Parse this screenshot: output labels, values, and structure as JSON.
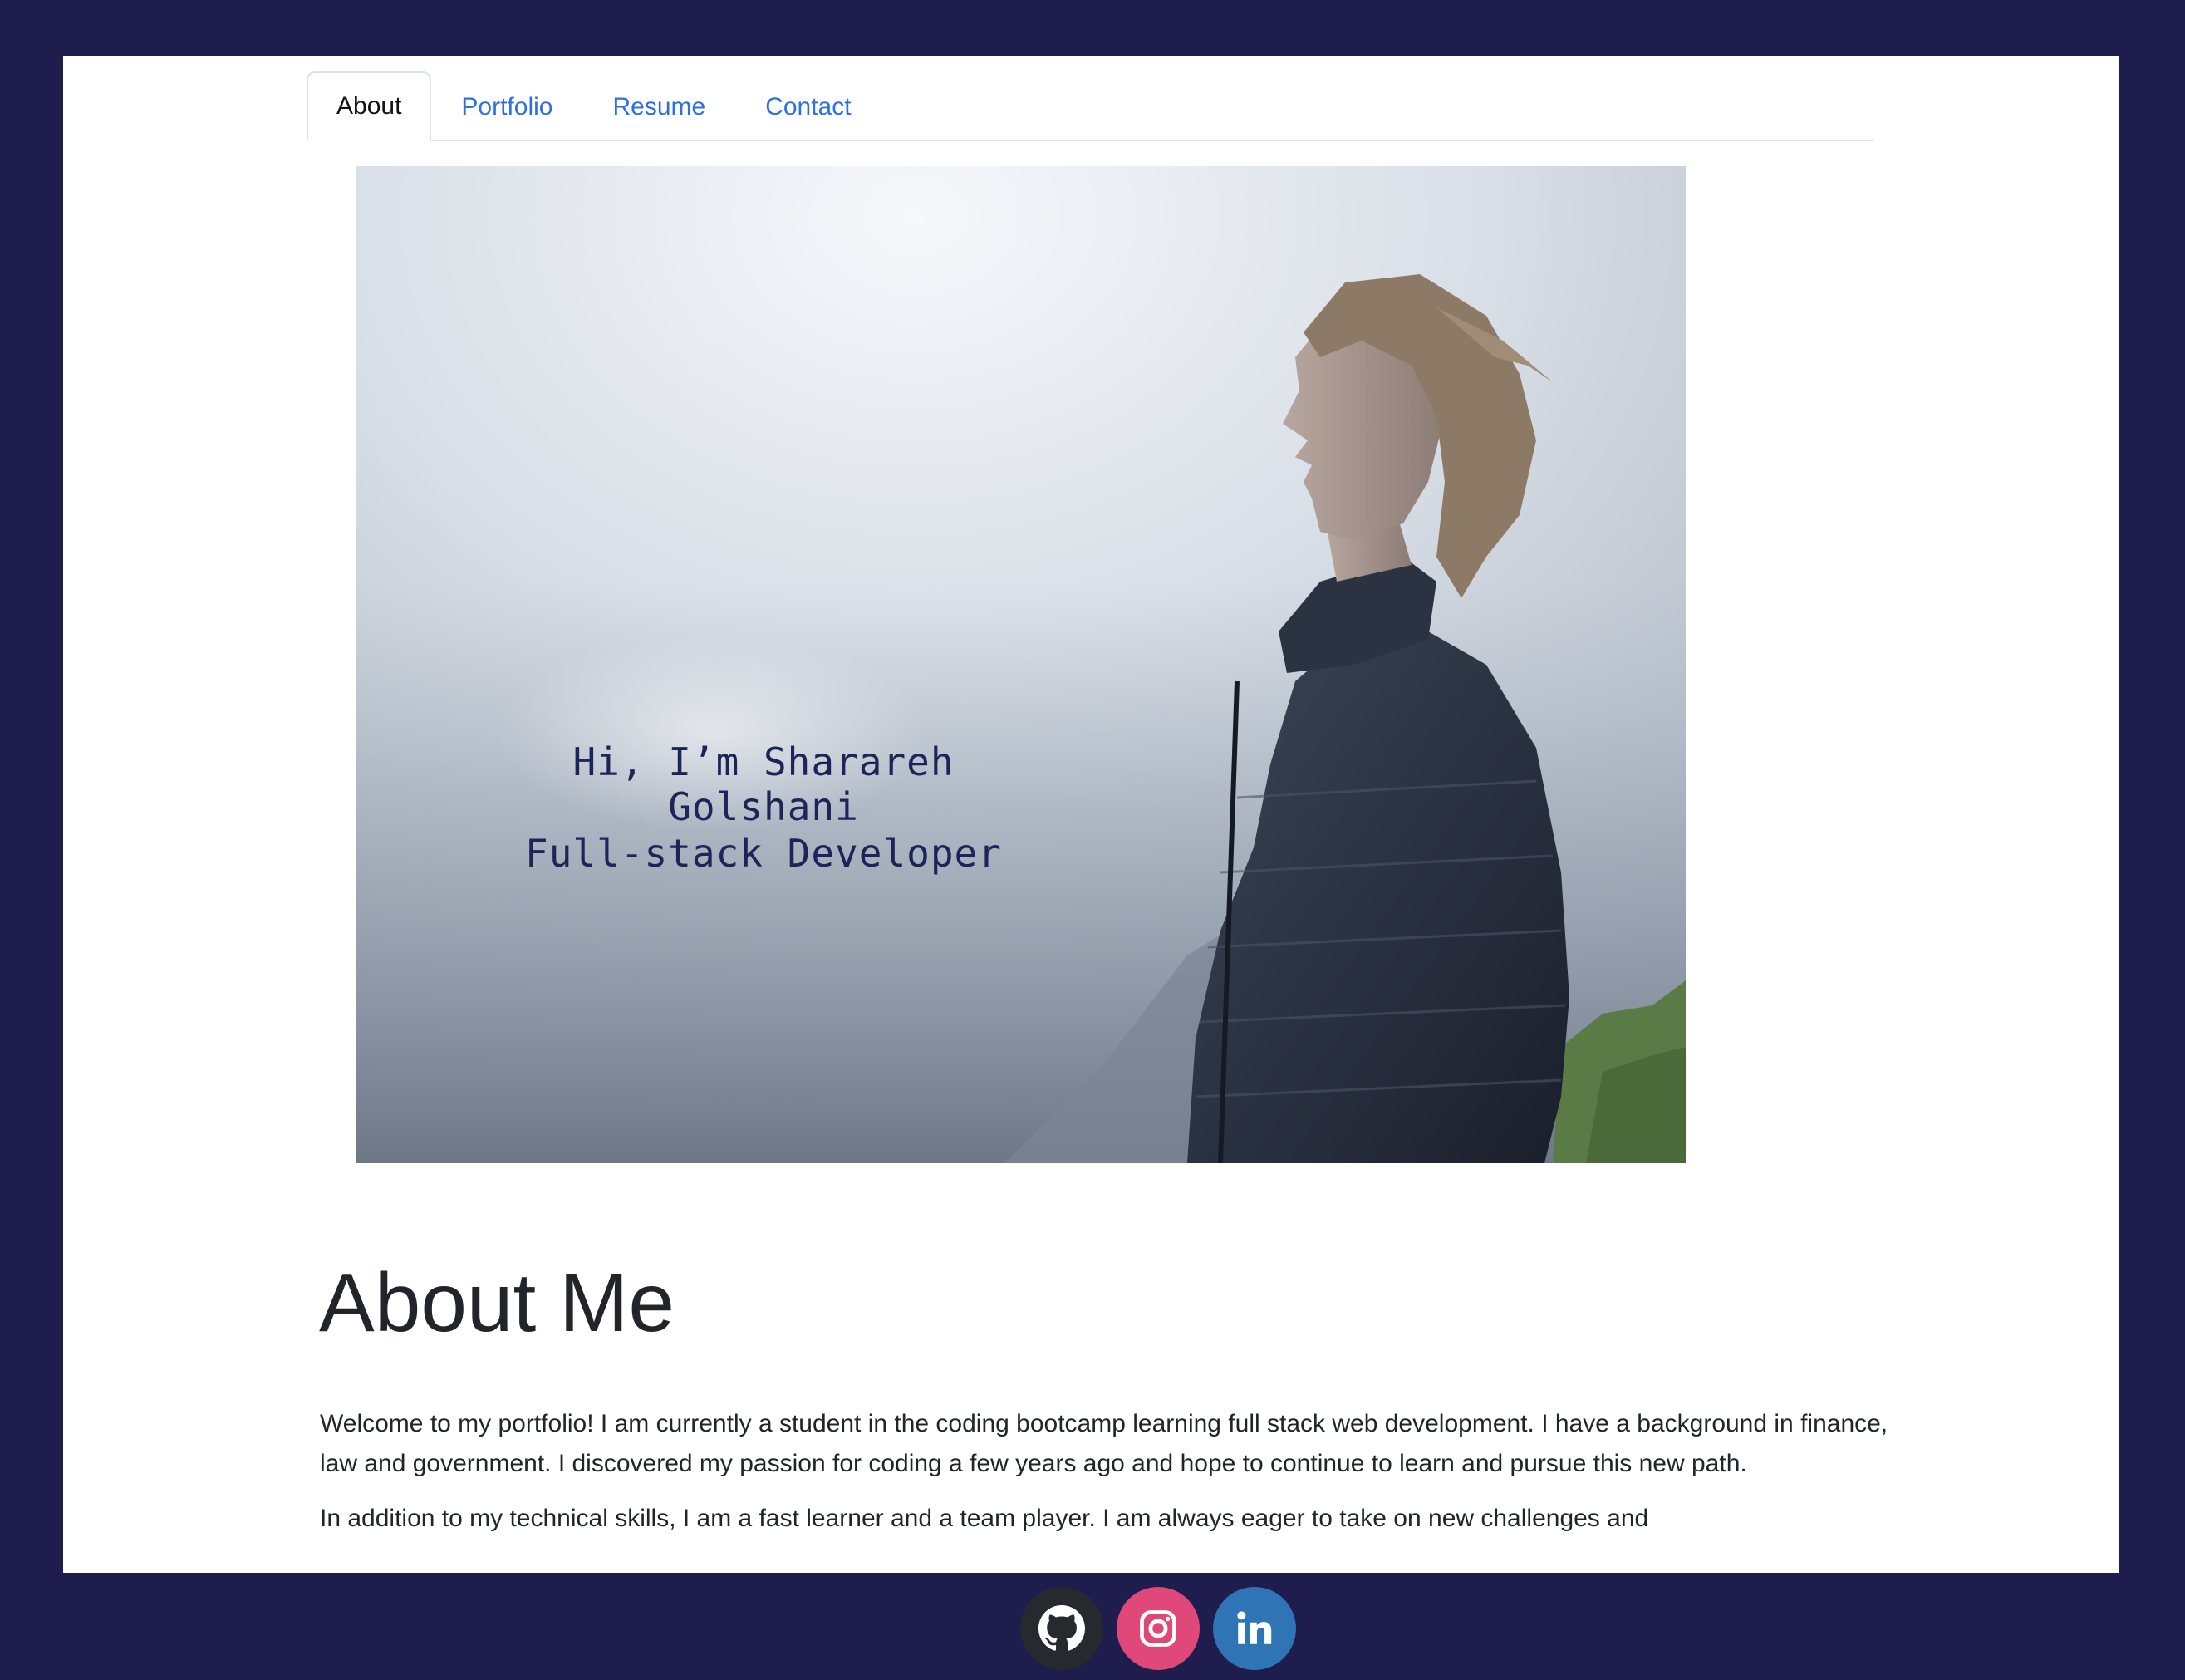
{
  "nav": {
    "tabs": [
      {
        "label": "About",
        "active": true
      },
      {
        "label": "Portfolio",
        "active": false
      },
      {
        "label": "Resume",
        "active": false
      },
      {
        "label": "Contact",
        "active": false
      }
    ]
  },
  "hero": {
    "greeting": "Hi, I’m Sharareh Golshani",
    "role": "Full-stack Developer"
  },
  "about": {
    "title": "About Me",
    "paragraph_1": "Welcome to my portfolio! I am currently a student in the coding bootcamp learning full stack web development. I have a background in finance, law and government. I discovered my passion for coding a few years ago and hope to continue to learn and pursue this new path.",
    "paragraph_2": "In addition to my technical skills, I am a fast learner and a team player. I am always eager to take on new challenges and"
  },
  "footer": {
    "social": [
      {
        "icon": "github-icon",
        "color": "#26292d"
      },
      {
        "icon": "instagram-icon",
        "color": "#df4879"
      },
      {
        "icon": "linkedin-icon",
        "color": "#2f75b5"
      }
    ]
  },
  "colors": {
    "background": "#1e1d4e",
    "link": "#2f6fe6",
    "text": "#212529"
  }
}
